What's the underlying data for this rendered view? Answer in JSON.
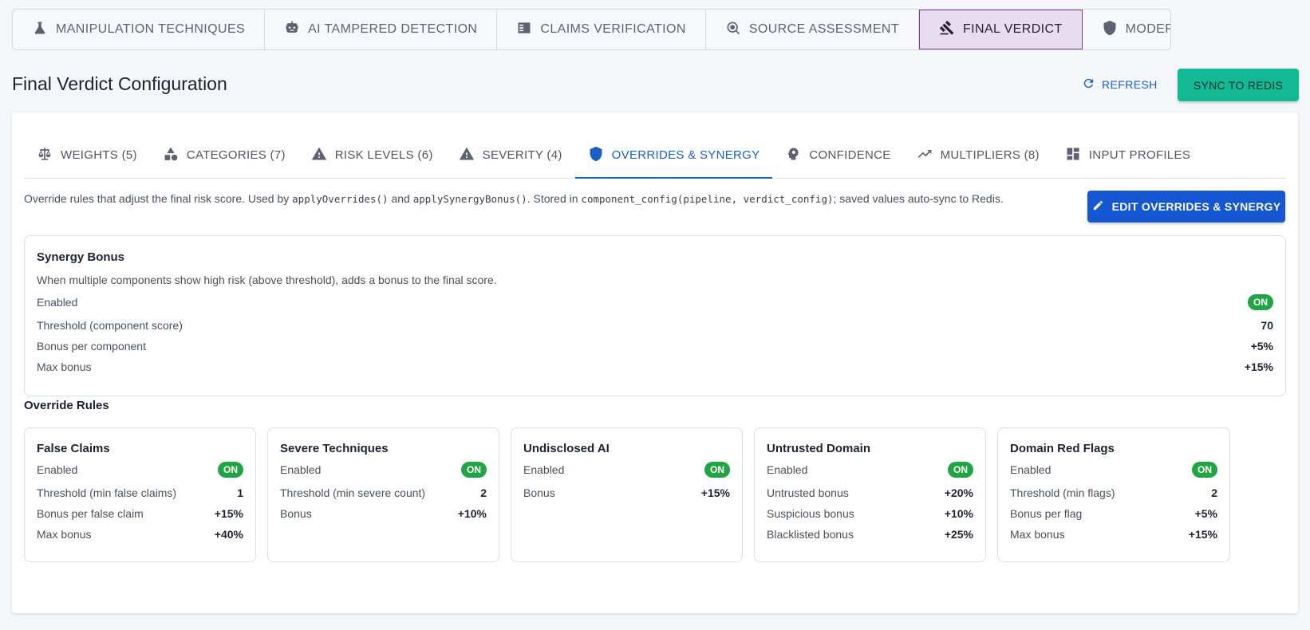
{
  "top_tabs": [
    {
      "label": "MANIPULATION TECHNIQUES",
      "icon": "flask-icon"
    },
    {
      "label": "AI TAMPERED DETECTION",
      "icon": "robot-icon"
    },
    {
      "label": "CLAIMS VERIFICATION",
      "icon": "fact-check-icon"
    },
    {
      "label": "SOURCE ASSESSMENT",
      "icon": "source-search-icon"
    },
    {
      "label": "FINAL VERDICT",
      "icon": "gavel-icon",
      "active": true
    },
    {
      "label": "MODERATION",
      "icon": "shield-icon"
    }
  ],
  "page_title": "Final Verdict Configuration",
  "refresh_label": "REFRESH",
  "sync_label": "SYNC TO REDIS",
  "sub_tabs": [
    {
      "label": "WEIGHTS (5)",
      "icon": "scale-icon"
    },
    {
      "label": "CATEGORIES (7)",
      "icon": "shapes-icon"
    },
    {
      "label": "RISK LEVELS (6)",
      "icon": "warning-icon"
    },
    {
      "label": "SEVERITY (4)",
      "icon": "warning-icon"
    },
    {
      "label": "OVERRIDES & SYNERGY",
      "icon": "shield-icon",
      "active": true
    },
    {
      "label": "CONFIDENCE",
      "icon": "psychology-icon"
    },
    {
      "label": "MULTIPLIERS (8)",
      "icon": "trending-up-icon"
    },
    {
      "label": "INPUT PROFILES",
      "icon": "dashboard-icon"
    }
  ],
  "description": {
    "t1": "Override rules that adjust the final risk score. Used by ",
    "c1": "applyOverrides()",
    "t2": " and ",
    "c2": "applySynergyBonus()",
    "t3": ". Stored in ",
    "c3": "component_config(pipeline, verdict_config)",
    "t4": "; saved values auto-sync to Redis."
  },
  "edit_label": "EDIT OVERRIDES & SYNERGY",
  "synergy": {
    "title": "Synergy Bonus",
    "desc": "When multiple components show high risk (above threshold), adds a bonus to the final score.",
    "rows": [
      {
        "label": "Enabled",
        "value": "ON",
        "badge": true
      },
      {
        "label": "Threshold (component score)",
        "value": "70"
      },
      {
        "label": "Bonus per component",
        "value": "+5%"
      },
      {
        "label": "Max bonus",
        "value": "+15%"
      }
    ]
  },
  "override_title": "Override Rules",
  "rules": [
    {
      "title": "False Claims",
      "rows": [
        {
          "label": "Enabled",
          "value": "ON",
          "badge": true
        },
        {
          "label": "Threshold (min false claims)",
          "value": "1"
        },
        {
          "label": "Bonus per false claim",
          "value": "+15%"
        },
        {
          "label": "Max bonus",
          "value": "+40%"
        }
      ]
    },
    {
      "title": "Severe Techniques",
      "rows": [
        {
          "label": "Enabled",
          "value": "ON",
          "badge": true
        },
        {
          "label": "Threshold (min severe count)",
          "value": "2"
        },
        {
          "label": "Bonus",
          "value": "+10%"
        }
      ]
    },
    {
      "title": "Undisclosed AI",
      "rows": [
        {
          "label": "Enabled",
          "value": "ON",
          "badge": true
        },
        {
          "label": "Bonus",
          "value": "+15%"
        }
      ]
    },
    {
      "title": "Untrusted Domain",
      "rows": [
        {
          "label": "Enabled",
          "value": "ON",
          "badge": true
        },
        {
          "label": "Untrusted bonus",
          "value": "+20%"
        },
        {
          "label": "Suspicious bonus",
          "value": "+10%"
        },
        {
          "label": "Blacklisted bonus",
          "value": "+25%"
        }
      ]
    },
    {
      "title": "Domain Red Flags",
      "rows": [
        {
          "label": "Enabled",
          "value": "ON",
          "badge": true
        },
        {
          "label": "Threshold (min flags)",
          "value": "2"
        },
        {
          "label": "Bonus per flag",
          "value": "+5%"
        },
        {
          "label": "Max bonus",
          "value": "+15%"
        }
      ]
    }
  ],
  "colors": {
    "accent": "#1a5fc4",
    "sync_button": "#13b894",
    "edit_button": "#1556d3",
    "on_badge": "#21a444",
    "active_top_tab_bg": "#e8dcef",
    "active_top_tab_border": "#7a3e8e"
  }
}
